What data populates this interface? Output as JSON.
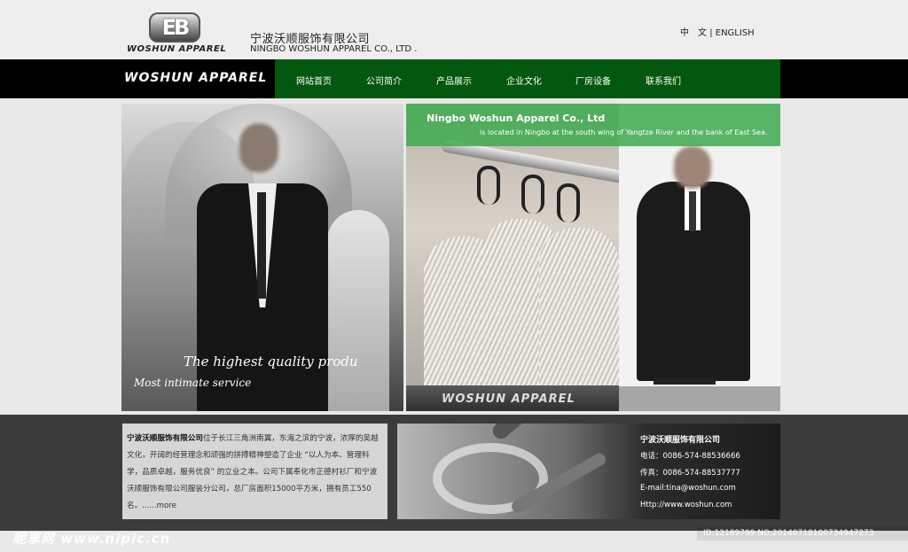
{
  "header": {
    "logo_mark": "EB",
    "logo_text": "WOSHUN APPAREL",
    "company_cn": "宁波沃顺服饰有限公司",
    "company_en": "NINGBO WOSHUN APPAREL CO., LTD .",
    "lang_cn": "中　文",
    "lang_sep": "|",
    "lang_en": "ENGLISH"
  },
  "nav": {
    "brand": "WOSHUN APPAREL",
    "items": [
      "网站首页",
      "公司简介",
      "产品展示",
      "企业文化",
      "厂房设备",
      "联系我们"
    ]
  },
  "banner": {
    "title": "Ningbo Woshun Apparel Co., Ltd",
    "subtitle": "is located in Ningbo at the south wing of Yangtze River and the bank of East Sea.",
    "quote1": "The highest quality produ",
    "quote2": "Most intimate service",
    "mid_brand": "WOSHUN APPAREL"
  },
  "about": {
    "company": "宁波沃顺服饰有限公司",
    "text": "位于长江三角洲南翼，东海之滨的宁波，浓厚的吴越文化，开阔的经营理念和顽强的拼搏精神塑造了企业 “以人为本、管理科学，品质卓越，服务优良” 的立业之本。公司下属奉化市正德村衫厂和宁波沃顺服饰有限公司服装分公司，总厂房面积15000平方米，拥有员工550名。",
    "more": "......more"
  },
  "contact": {
    "title": "宁波沃顺服饰有限公司",
    "phone": "电话：0086-574-88536666",
    "fax": "传真：0086-574-88537777",
    "email": "E-mail:tina@woshun.com",
    "url": "Http://www.woshun.com"
  },
  "watermark": {
    "site": "昵享网 www.nipic.cn",
    "id": "ID:12189799 NO:20140718100734947273"
  },
  "colors": {
    "nav_green": "#04570e",
    "banner_green": "#3eaa50",
    "dark_band": "#3b3b3b"
  }
}
